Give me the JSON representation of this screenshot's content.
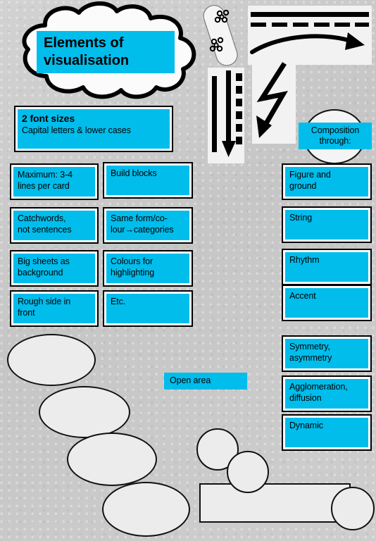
{
  "poster": {
    "title_lines": [
      "Elements of",
      "visualisation"
    ],
    "background_color": "#c9c9c9",
    "accent_color": "#00bdec"
  },
  "font_sizes_card": {
    "heading": "2 font sizes",
    "subtext": "Capital letters & lower cases"
  },
  "left_column": [
    {
      "lines": [
        "Maximum: 3-4",
        "lines per card"
      ]
    },
    {
      "lines": [
        "Catchwords,",
        "not sentences"
      ]
    },
    {
      "lines": [
        "Big sheets as",
        "background"
      ]
    },
    {
      "lines": [
        "Rough side in",
        "front"
      ]
    }
  ],
  "middle_column": [
    {
      "lines": [
        "Build blocks"
      ]
    },
    {
      "lines": [
        "Same form/co-",
        "lour→categories"
      ]
    },
    {
      "lines": [
        "Colours for",
        "highlighting"
      ]
    },
    {
      "lines": [
        "Etc."
      ]
    }
  ],
  "composition": {
    "header_lines": [
      "Composition",
      "through:"
    ],
    "items": [
      {
        "lines": [
          "Figure and",
          "ground"
        ]
      },
      {
        "lines": [
          "String"
        ]
      },
      {
        "lines": [
          "Rhythm"
        ]
      },
      {
        "lines": [
          "Accent"
        ]
      },
      {
        "lines": [
          "Symmetry,",
          "asymmetry"
        ]
      },
      {
        "lines": [
          "Agglomeration,",
          "diffusion"
        ]
      },
      {
        "lines": [
          "Dynamic"
        ]
      }
    ]
  },
  "open_area": {
    "label": "Open area"
  },
  "graphics": {
    "capsule_dots": "dot-cluster-capsule",
    "solid_line": "solid-line",
    "dashed_line": "dashed-line",
    "curved_arrow": "curved-arrow-right",
    "vertical_bar": "vertical-solid-bar",
    "vertical_arrow": "vertical-arrow-down",
    "dashed_column": "dashed-vertical-column",
    "lightning_arrow": "zigzag-lightning-arrow"
  }
}
